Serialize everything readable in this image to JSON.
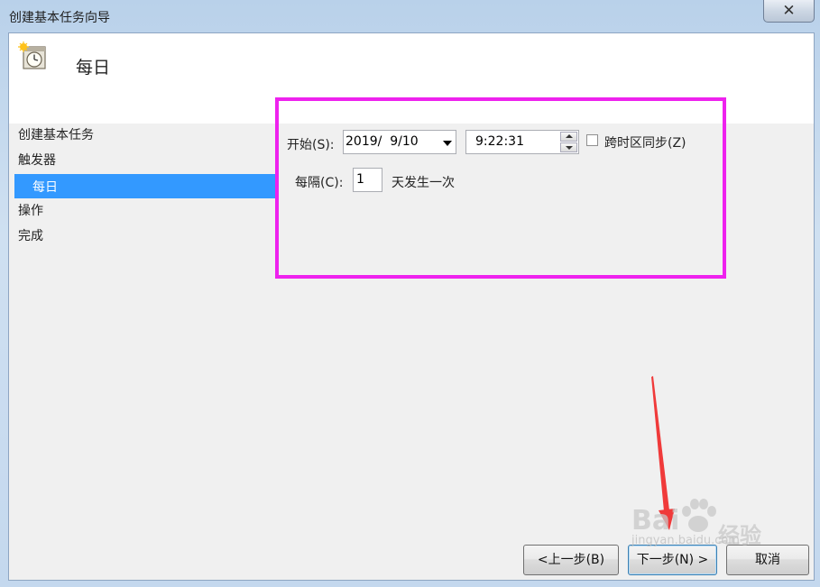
{
  "window": {
    "title": "创建基本任务向导",
    "close_glyph": "✕"
  },
  "header": {
    "title": "每日",
    "icon": "clock-calendar-icon"
  },
  "nav": {
    "items": [
      {
        "label": "创建基本任务",
        "selected": false
      },
      {
        "label": "触发器",
        "selected": false
      },
      {
        "label": "每日",
        "selected": true
      },
      {
        "label": "操作",
        "selected": false
      },
      {
        "label": "完成",
        "selected": false
      }
    ]
  },
  "form": {
    "start_label": "开始(S):",
    "start_date": "2019/  9/10",
    "start_time": "9:22:31",
    "sync_timezone_label": "跨时区同步(Z)",
    "sync_timezone_checked": false,
    "recur_label": "每隔(C):",
    "recur_value": "1",
    "recur_suffix": "天发生一次"
  },
  "buttons": {
    "back": "<上一步(B)",
    "next": "下一步(N) >",
    "cancel": "取消"
  },
  "watermark": {
    "brand": "Bai",
    "brand_tail": "经验",
    "url": "jingyan.baidu.com"
  },
  "colors": {
    "highlight": "#ee22ee",
    "selection": "#3399ff",
    "arrow": "#f03a3a"
  }
}
